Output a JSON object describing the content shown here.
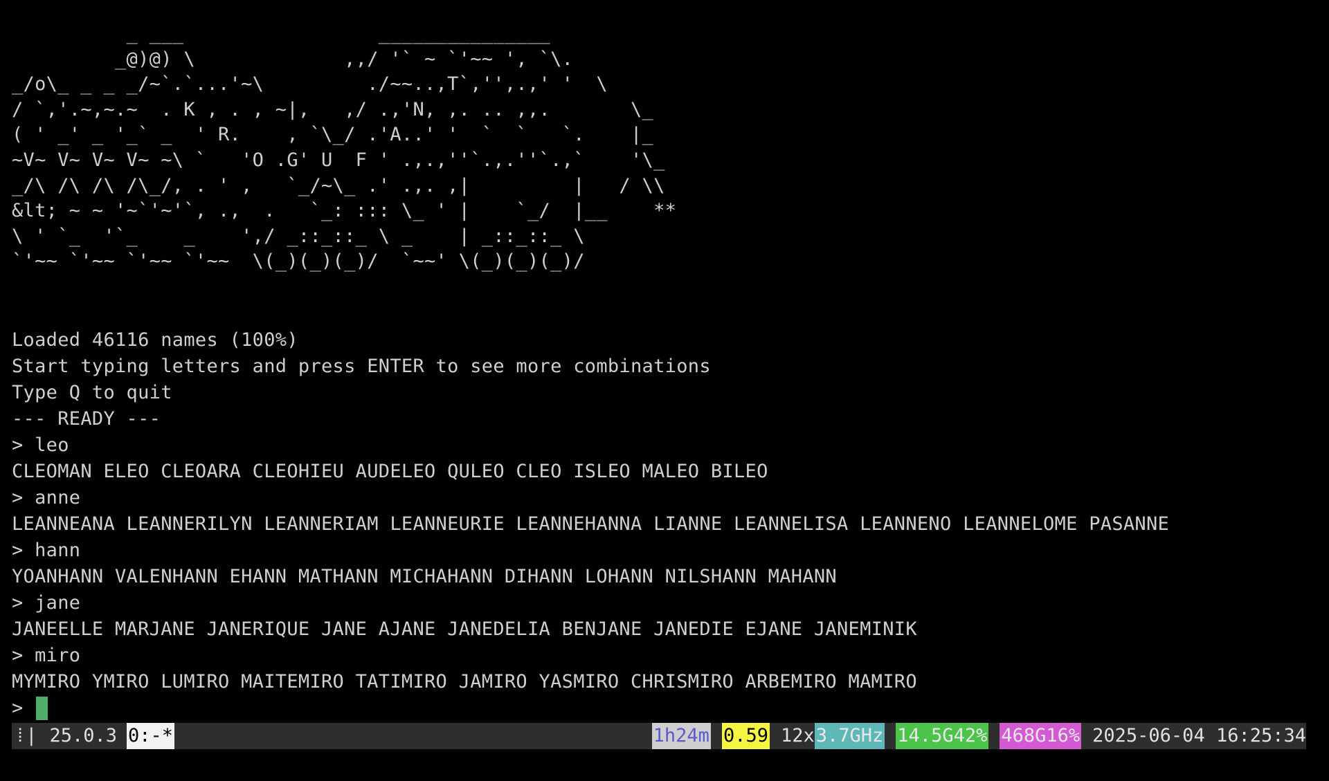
{
  "banner": [
    "          _ ___                 _______________",
    "         _@)@) \\             ,,/ '` ~ `'~~ ', `\\.",
    "_/o\\_ _ _ _/~`.`...'~\\         ./~~..,T`,'',.,' '  \\",
    "/ `,'.~,~.~  . K , . , ~|,   ,/ .,'N, ,. .. ,,.       \\_",
    "( ' _' _ '_` _  ' R.    , `\\_/ .'A..' '  `  `   `.    |_",
    "~V~ V~ V~ V~ ~\\ `   'O .G' U  F ' .,.,''`.,.''`.,`    '\\_",
    "_/\\ /\\ /\\ /\\_/, . ' ,   `_/~\\_ .' .,. ,|         |   / \\\\",
    "&lt; ~ ~ '~`'~'`, .,  .   `_: ::: \\_ ' |    `_/  |__    **",
    "\\ ' `_  '`_    _    ',/ _::_::_ \\ _    | _::_::_ \\",
    "`'~~ `'~~ `'~~ `'~~  \\(_)(_)(_)/  `~~' \\(_)(_)(_)/"
  ],
  "messages": {
    "loaded": "Loaded 46116 names (100%)",
    "instructions": "Start typing letters and press ENTER to see more combinations",
    "quit_hint": "Type Q to quit",
    "ready": "--- READY ---"
  },
  "history": [
    {
      "query": "> leo",
      "results": "CLEOMAN ELEO CLEOARA CLEOHIEU AUDELEO QULEO CLEO ISLEO MALEO BILEO"
    },
    {
      "query": "> anne",
      "results": "LEANNEANA LEANNERILYN LEANNERIAM LEANNEURIE LEANNEHANNA LIANNE LEANNELISA LEANNENO LEANNELOME PASANNE"
    },
    {
      "query": "> hann",
      "results": "YOANHANN VALENHANN EHANN MATHANN MICHAHANN DIHANN LOHANN NILSHANN MAHANN"
    },
    {
      "query": "> jane",
      "results": "JANEELLE MARJANE JANERIQUE JANE AJANE JANEDELIA BENJANE JANEDIE EJANE JANEMINIK"
    },
    {
      "query": "> miro",
      "results": "MYMIRO YMIRO LUMIRO MAITEMIRO TATIMIRO JAMIRO YASMIRO CHRISMIRO ARBEMIRO MAMIRO"
    }
  ],
  "prompt": {
    "symbol": "> ",
    "value": ""
  },
  "statusbar": {
    "grip_icon": "pane-grip-icon",
    "grip": "⁞|",
    "version": "25.0.3",
    "window": "0:-*",
    "uptime": "1h24m",
    "load": "0.59",
    "cpu_count": "12x",
    "cpu_freq": "3.7GHz",
    "memory": "14.5G42%",
    "disk": "468G16%",
    "datetime": "2025-06-04 16:25:34",
    "colors": {
      "bar": "#2e2e2e",
      "uptime": "#cfcfcf",
      "load": "#f5f542",
      "freq": "#5fb8b8",
      "memory": "#4cc44c",
      "disk": "#d35ad3",
      "cursor": "#4fae6a"
    }
  }
}
